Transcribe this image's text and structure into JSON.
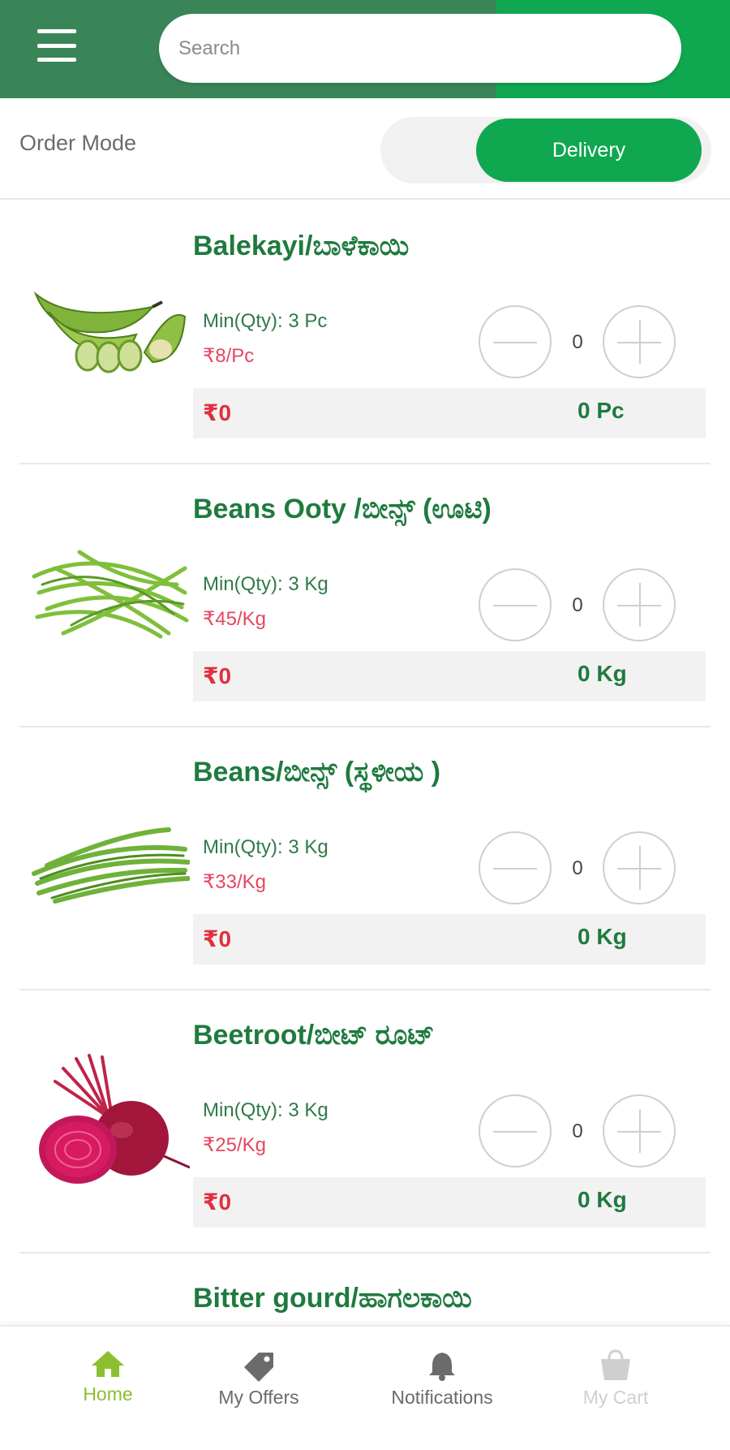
{
  "header": {
    "search_placeholder": "Search",
    "menu_icon": "hamburger-menu-icon"
  },
  "order_mode": {
    "label": "Order Mode",
    "selected": "Delivery"
  },
  "products": [
    {
      "name": "Balekayi/ಬಾಳೆಕಾಯಿ",
      "min_qty": "Min(Qty): 3 Pc",
      "price": "₹8/Pc",
      "qty": "0",
      "total": "₹0",
      "total_qty": "0 Pc",
      "image": "raw-banana"
    },
    {
      "name": "Beans Ooty /ಬೀನ್ಸ್ (ಊಟಿ)",
      "min_qty": "Min(Qty): 3 Kg",
      "price": "₹45/Kg",
      "qty": "0",
      "total": "₹0",
      "total_qty": "0 Kg",
      "image": "green-beans"
    },
    {
      "name": "Beans/ಬೀನ್ಸ್ (ಸ್ಥಳೀಯ )",
      "min_qty": "Min(Qty): 3 Kg",
      "price": "₹33/Kg",
      "qty": "0",
      "total": "₹0",
      "total_qty": "0 Kg",
      "image": "green-beans"
    },
    {
      "name": "Beetroot/ಬೀಟ್ ರೂಟ್",
      "min_qty": "Min(Qty): 3 Kg",
      "price": "₹25/Kg",
      "qty": "0",
      "total": "₹0",
      "total_qty": "0 Kg",
      "image": "beetroot"
    },
    {
      "name": "Bitter gourd/ಹಾಗಲಕಾಯಿ",
      "min_qty": "",
      "price": "",
      "qty": "",
      "total": "",
      "total_qty": "",
      "image": "bitter-gourd"
    }
  ],
  "bottom_nav": [
    {
      "label": "Home",
      "icon": "home-icon",
      "active": true
    },
    {
      "label": "My Offers",
      "icon": "tag-icon",
      "active": false
    },
    {
      "label": "Notifications",
      "icon": "bell-icon",
      "active": false
    },
    {
      "label": "My Cart",
      "icon": "cart-icon",
      "active": false,
      "disabled": true
    }
  ],
  "colors": {
    "brand_green": "#0fa850",
    "header_dark_green": "#3a8557",
    "name_green": "#1f7a3f",
    "price_red": "#e5475f",
    "home_active": "#8bbf2f"
  }
}
